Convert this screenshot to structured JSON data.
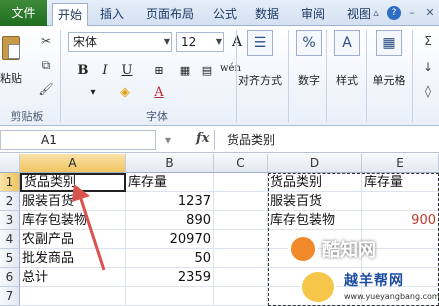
{
  "ribbon_tabs": [
    "文件",
    "开始",
    "插入",
    "页面布局",
    "公式",
    "数据",
    "审阅",
    "视图"
  ],
  "clipboard": {
    "paste_label": "粘贴",
    "group_label": "剪贴板"
  },
  "font": {
    "name": "宋体",
    "size": "12",
    "group_label": "字体",
    "bold": "B",
    "italic": "I",
    "underline": "U",
    "grow": "A",
    "shrink": "A",
    "wen": "wén"
  },
  "alignment": {
    "label": "对齐方式"
  },
  "number": {
    "label": "数字",
    "symbol": "%"
  },
  "styles": {
    "label": "样式",
    "symbol": "A"
  },
  "cells": {
    "label": "单元格"
  },
  "formula_bar": {
    "name_box": "A1",
    "fx": "fx",
    "content": "货品类别"
  },
  "columns": [
    "A",
    "B",
    "C",
    "D",
    "E"
  ],
  "rows": [
    "1",
    "2",
    "3",
    "4",
    "5",
    "6",
    "7"
  ],
  "sheet": {
    "A": [
      "货品类别",
      "服装百货",
      "库存包装物",
      "农副产品",
      "批发商品",
      "总计"
    ],
    "B": [
      "库存量",
      "1237",
      "890",
      "20970",
      "50",
      "2359"
    ],
    "D": [
      "货品类别",
      "服装百货",
      "库存包装物"
    ],
    "E": [
      "库存量",
      "",
      "900"
    ]
  },
  "watermark": {
    "site1": "酷知网",
    "site2": "越羊帮网",
    "url": "www.yueyangbang.com"
  },
  "colors": {
    "file_tab": "#2a7a2a",
    "selection": "#f0c460",
    "arrow": "#d9534f"
  }
}
